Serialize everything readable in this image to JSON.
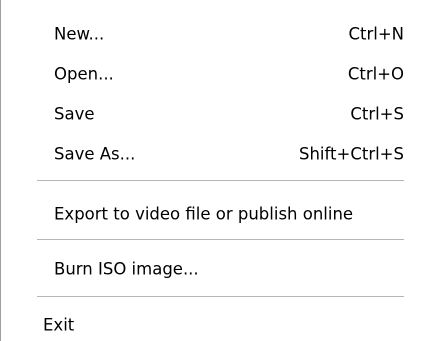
{
  "menu": {
    "items": [
      {
        "label": "New...",
        "shortcut": "Ctrl+N"
      },
      {
        "label": "Open...",
        "shortcut": "Ctrl+O"
      },
      {
        "label": "Save",
        "shortcut": "Ctrl+S"
      },
      {
        "label": "Save As...",
        "shortcut": "Shift+Ctrl+S"
      },
      {
        "label": "Export to video file or publish online",
        "shortcut": ""
      },
      {
        "label": "Burn ISO image...",
        "shortcut": ""
      },
      {
        "label": "Exit",
        "shortcut": ""
      }
    ]
  }
}
